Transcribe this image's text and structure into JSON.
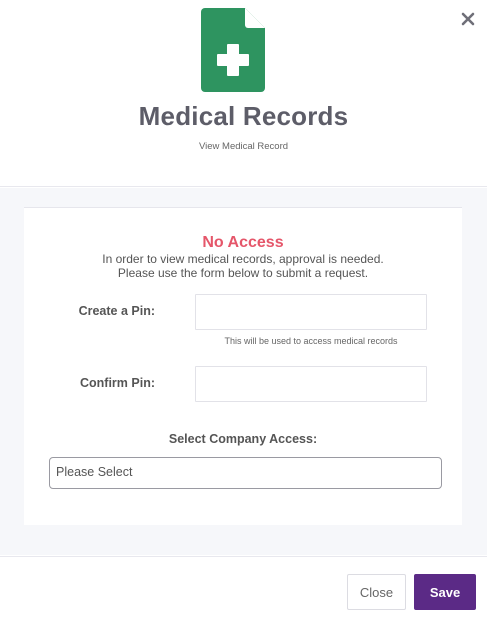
{
  "header": {
    "title": "Medical Records",
    "subtitle": "View Medical Record"
  },
  "access": {
    "status": "No Access",
    "message_line1": "In order to view medical records, approval is needed.",
    "message_line2": "Please use the form below to submit a request."
  },
  "form": {
    "create_pin_label": "Create a Pin:",
    "create_pin_hint": "This will be used to access medical records",
    "confirm_pin_label": "Confirm Pin:",
    "company_label": "Select Company Access:",
    "company_select_value": "Please Select"
  },
  "footer": {
    "close_label": "Close",
    "save_label": "Save"
  },
  "colors": {
    "icon_green": "#2e9460",
    "no_access_red": "#e5566a",
    "save_purple": "#5b2a86"
  },
  "icons": {
    "close": "close-icon",
    "document": "medical-document-icon"
  }
}
